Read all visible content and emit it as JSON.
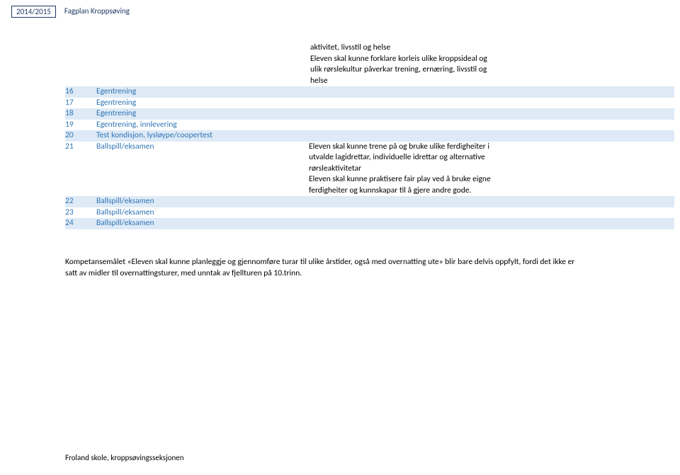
{
  "header": {
    "year": "2014/2015",
    "title": "Fagplan Kroppsøving"
  },
  "preText": {
    "l1": "aktivitet, livsstil og helse",
    "l2": "Eleven skal kunne forklare korleis ulike kroppsideal og",
    "l3": "ulik rørslekultur påverkar trening, ernæring, livsstil og",
    "l4": "helse"
  },
  "rows": {
    "r16": {
      "num": "16",
      "topic": "Egentrening"
    },
    "r17": {
      "num": "17",
      "topic": "Egentrening"
    },
    "r18": {
      "num": "18",
      "topic": "Egentrening"
    },
    "r19": {
      "num": "19",
      "topic": "Egentrening, innlevering"
    },
    "r20": {
      "num": "20",
      "topic": "Test kondisjon, lysløype/coopertest"
    },
    "r21": {
      "num": "21",
      "topic": "Ballspill/eksamen",
      "d1": "Eleven skal kunne trene på og bruke ulike ferdigheiter i",
      "d2": "utvalde lagidrettar, individuelle idrettar og alternative",
      "d3": "rørsleaktivitetar",
      "d4": "Eleven skal kunne praktisere fair play ved å bruke eigne",
      "d5": "ferdigheiter og kunnskapar til å gjere andre gode."
    },
    "r22": {
      "num": "22",
      "topic": "Ballspill/eksamen"
    },
    "r23": {
      "num": "23",
      "topic": "Ballspill/eksamen"
    },
    "r24": {
      "num": "24",
      "topic": "Ballspill/eksamen"
    }
  },
  "footer": {
    "l1": "Kompetansemålet «Eleven skal kunne planleggje og gjennomføre turar til ulike årstider, også med overnatting ute» blir bare delvis oppfylt, fordi det ikke er",
    "l2": "satt av midler til overnattingsturer, med unntak av fjellturen på 10.trinn."
  },
  "credit": "Froland skole, kroppsøvingsseksjonen"
}
